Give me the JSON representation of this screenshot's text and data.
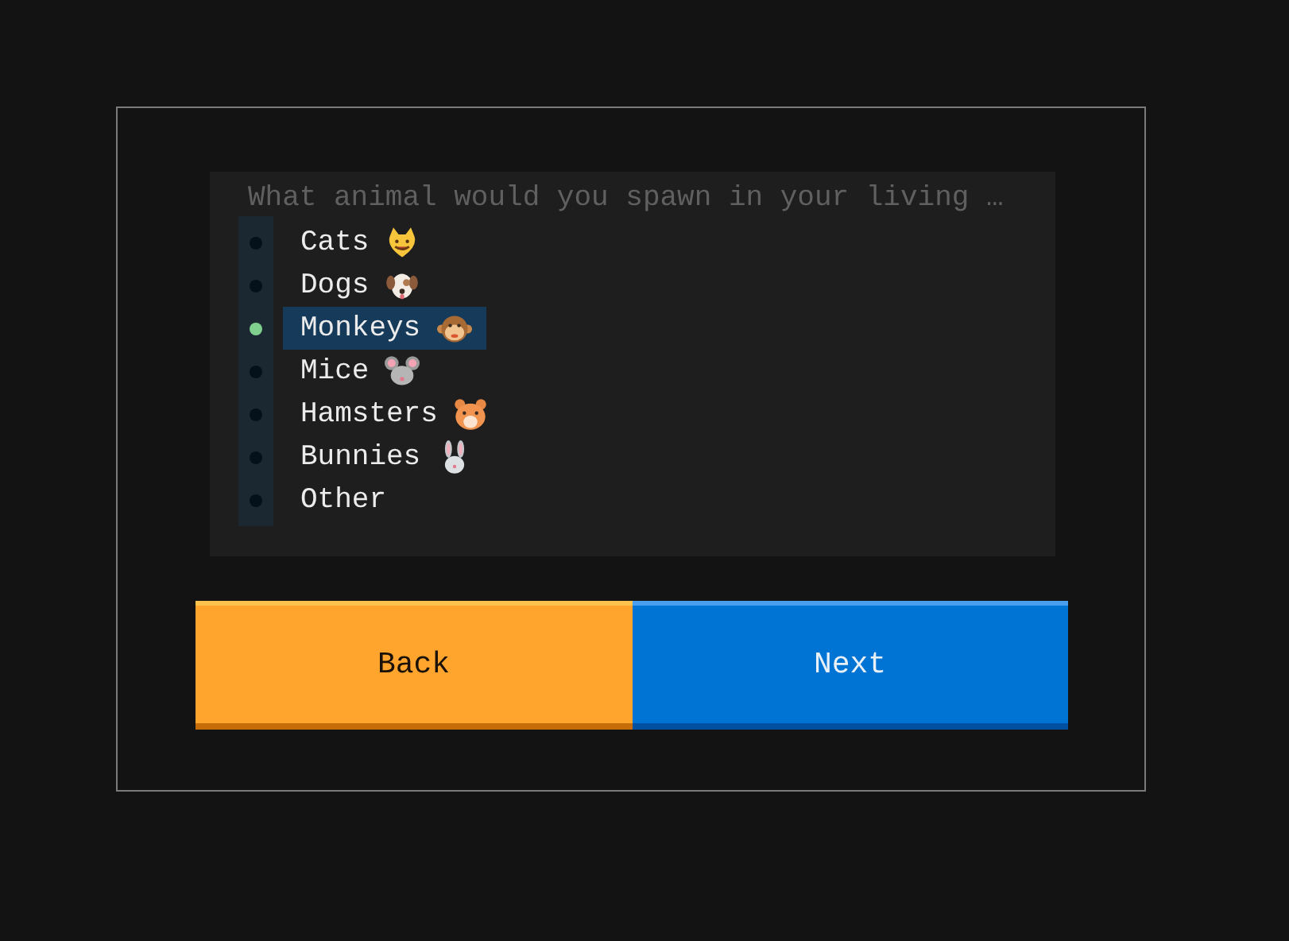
{
  "question": "What animal would you spawn in your living …",
  "options": [
    {
      "label": "Cats",
      "kind": "cat",
      "selected": false
    },
    {
      "label": "Dogs",
      "kind": "dog",
      "selected": false
    },
    {
      "label": "Monkeys",
      "kind": "monkey",
      "selected": true
    },
    {
      "label": "Mice",
      "kind": "mouse",
      "selected": false
    },
    {
      "label": "Hamsters",
      "kind": "hamster",
      "selected": false
    },
    {
      "label": "Bunnies",
      "kind": "rabbit",
      "selected": false
    },
    {
      "label": "Other",
      "kind": "plain",
      "selected": false
    }
  ],
  "buttons": [
    {
      "label": "Back",
      "kind": "back"
    },
    {
      "label": "Next",
      "kind": "next"
    }
  ]
}
